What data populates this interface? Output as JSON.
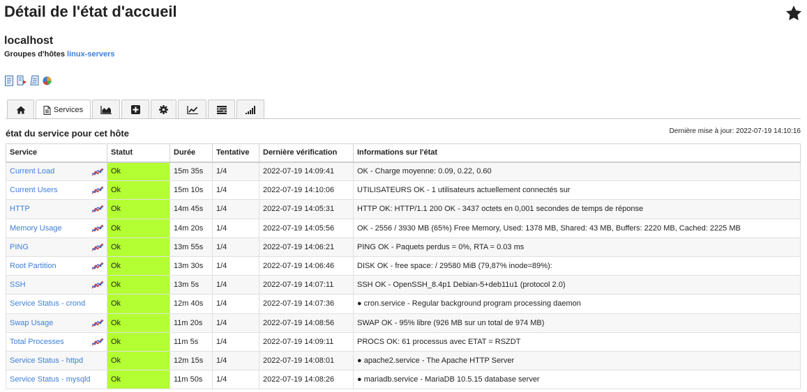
{
  "page": {
    "title": "Détail de l'état d'accueil",
    "host_name": "localhost",
    "host_groups_label": "Groupes d'hôtes",
    "host_group_link": "linux-servers"
  },
  "action_icons": [
    "notes-icon",
    "command-icon",
    "report-icon",
    "chart-pie-icon"
  ],
  "tabs": [
    {
      "name": "home",
      "label": "",
      "icon": "home-icon"
    },
    {
      "name": "services",
      "label": "Services",
      "icon": "document-icon",
      "active": true
    },
    {
      "name": "area-chart",
      "label": "",
      "icon": "area-chart-icon"
    },
    {
      "name": "add",
      "label": "",
      "icon": "plus-square-icon"
    },
    {
      "name": "settings",
      "label": "",
      "icon": "gear-icon"
    },
    {
      "name": "line-chart",
      "label": "",
      "icon": "line-chart-icon"
    },
    {
      "name": "list",
      "label": "",
      "icon": "list-icon"
    },
    {
      "name": "signal",
      "label": "",
      "icon": "signal-bars-icon"
    }
  ],
  "section": {
    "title": "état du service pour cet hôte",
    "last_update": "Dernière mise à jour: 2022-07-19 14:10:16"
  },
  "table": {
    "headers": {
      "service": "Service",
      "status": "Statut",
      "duration": "Durée",
      "attempt": "Tentative",
      "last_check": "Dernière vérification",
      "info": "Informations sur l'état"
    },
    "rows": [
      {
        "service": "Current Load",
        "graph": true,
        "status": "Ok",
        "duration": "15m 35s",
        "attempt": "1/4",
        "last_check": "2022-07-19 14:09:41",
        "info": "OK - Charge moyenne: 0.09, 0.22, 0.60"
      },
      {
        "service": "Current Users",
        "graph": true,
        "status": "Ok",
        "duration": "15m 10s",
        "attempt": "1/4",
        "last_check": "2022-07-19 14:10:06",
        "info": "UTILISATEURS OK - 1 utilisateurs actuellement connectés sur"
      },
      {
        "service": "HTTP",
        "graph": true,
        "status": "Ok",
        "duration": "14m 45s",
        "attempt": "1/4",
        "last_check": "2022-07-19 14:05:31",
        "info": "HTTP OK: HTTP/1.1 200 OK - 3437 octets en 0,001 secondes de temps de réponse"
      },
      {
        "service": "Memory Usage",
        "graph": true,
        "status": "Ok",
        "duration": "14m 20s",
        "attempt": "1/4",
        "last_check": "2022-07-19 14:05:56",
        "info": "OK - 2556 / 3930 MB (65%) Free Memory, Used: 1378 MB, Shared: 43 MB, Buffers: 2220 MB, Cached: 2225 MB"
      },
      {
        "service": "PING",
        "graph": true,
        "status": "Ok",
        "duration": "13m 55s",
        "attempt": "1/4",
        "last_check": "2022-07-19 14:06:21",
        "info": "PING OK - Paquets perdus = 0%, RTA = 0.03 ms"
      },
      {
        "service": "Root Partition",
        "graph": true,
        "status": "Ok",
        "duration": "13m 30s",
        "attempt": "1/4",
        "last_check": "2022-07-19 14:06:46",
        "info": "DISK OK - free space: / 29580 MiB (79,87% inode=89%):"
      },
      {
        "service": "SSH",
        "graph": true,
        "status": "Ok",
        "duration": "13m 5s",
        "attempt": "1/4",
        "last_check": "2022-07-19 14:07:11",
        "info": "SSH OK - OpenSSH_8.4p1 Debian-5+deb11u1 (protocol 2.0)"
      },
      {
        "service": "Service Status - crond",
        "graph": false,
        "status": "Ok",
        "duration": "12m 40s",
        "attempt": "1/4",
        "last_check": "2022-07-19 14:07:36",
        "info": "● cron.service - Regular background program processing daemon"
      },
      {
        "service": "Swap Usage",
        "graph": true,
        "status": "Ok",
        "duration": "11m 20s",
        "attempt": "1/4",
        "last_check": "2022-07-19 14:08:56",
        "info": "SWAP OK - 95% libre (926 MB sur un total de 974 MB)"
      },
      {
        "service": "Total Processes",
        "graph": true,
        "status": "Ok",
        "duration": "11m 5s",
        "attempt": "1/4",
        "last_check": "2022-07-19 14:09:11",
        "info": "PROCS OK: 61 processus avec ETAT = RSZDT"
      },
      {
        "service": "Service Status - httpd",
        "graph": false,
        "status": "Ok",
        "duration": "12m 15s",
        "attempt": "1/4",
        "last_check": "2022-07-19 14:08:01",
        "info": "● apache2.service - The Apache HTTP Server"
      },
      {
        "service": "Service Status - mysqld",
        "graph": false,
        "status": "Ok",
        "duration": "11m 50s",
        "attempt": "1/4",
        "last_check": "2022-07-19 14:08:26",
        "info": "● mariadb.service - MariaDB 10.5.15 database server"
      }
    ]
  },
  "colors": {
    "status_ok": "#b3ff33",
    "link": "#3d7fd8"
  }
}
